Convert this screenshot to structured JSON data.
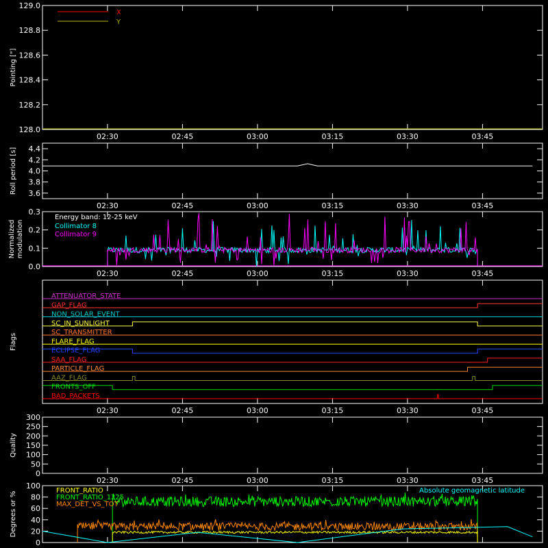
{
  "time_axis": {
    "ticks": [
      "02:30",
      "02:45",
      "03:00",
      "03:15",
      "03:30",
      "03:45"
    ]
  },
  "chart_data": [
    {
      "type": "line",
      "panel": "pointing",
      "ylabel": "Pointing [\"]",
      "ylim": [
        128.0,
        129.0
      ],
      "yticks": [
        "128.0",
        "128.2",
        "128.4",
        "128.6",
        "128.8",
        "129.0"
      ],
      "series": [
        {
          "name": "X",
          "color": "#ff0000",
          "values": []
        },
        {
          "name": "Y",
          "color": "#b8b800",
          "values": []
        }
      ]
    },
    {
      "type": "line",
      "panel": "roll",
      "ylabel": "Roll period [s]",
      "ylim": [
        3.5,
        4.5
      ],
      "yticks": [
        "3.6",
        "3.8",
        "4.0",
        "4.2",
        "4.4"
      ],
      "series": [
        {
          "color": "#ffffff",
          "x": [
            "02:17",
            "02:45",
            "03:00",
            "03:08",
            "03:10",
            "03:11",
            "03:12",
            "03:20",
            "03:30",
            "03:40",
            "03:55"
          ],
          "values": [
            4.09,
            4.09,
            4.09,
            4.09,
            4.13,
            4.11,
            4.09,
            4.09,
            4.09,
            4.09,
            4.09
          ]
        }
      ]
    },
    {
      "type": "line",
      "panel": "modulation",
      "ylabel": "Normalized modulation",
      "ylim": [
        0.0,
        0.3
      ],
      "yticks": [
        "0.0",
        "0.1",
        "0.2",
        "0.3"
      ],
      "annotation": "Energy band: 12-25 keV",
      "series": [
        {
          "name": "Collimator 8",
          "color": "#00ffff"
        },
        {
          "name": "Collimator 9",
          "color": "#ff00ff"
        }
      ],
      "active_range": [
        "02:30",
        "03:44"
      ],
      "baseline": 0.09
    },
    {
      "type": "line",
      "panel": "flags",
      "ylabel": "Flags",
      "flags": [
        {
          "name": "ATTENUATOR_STATE",
          "color": "#cc33cc",
          "steps": []
        },
        {
          "name": "GAP_FLAG",
          "color": "#ff3333",
          "steps": [
            [
              "03:44",
              1
            ]
          ]
        },
        {
          "name": "NON_SOLAR_EVENT",
          "color": "#00cccc",
          "steps": []
        },
        {
          "name": "SC_IN_SUNLIGHT",
          "color": "#ffff44",
          "steps": [
            [
              "02:35",
              1
            ],
            [
              "03:44",
              0
            ]
          ]
        },
        {
          "name": "SC_TRANSMITTER",
          "color": "#ff7733",
          "steps": []
        },
        {
          "name": "FLARE_FLAG",
          "color": "#ffff00",
          "steps": []
        },
        {
          "name": "ECLIPSE_FLAG",
          "color": "#2244ff",
          "steps": [
            [
              "02:35",
              0
            ],
            [
              "03:44",
              1
            ]
          ]
        },
        {
          "name": "SAA_FLAG",
          "color": "#ff2222",
          "steps": [
            [
              "03:46",
              1
            ]
          ]
        },
        {
          "name": "PARTICLE_FLAG",
          "color": "#ff8833",
          "steps": [
            [
              "03:42",
              1
            ]
          ]
        },
        {
          "name": "AAZ_FLAG",
          "color": "#888822",
          "steps": [
            [
              "02:35",
              1
            ],
            [
              "02:35.5",
              0
            ],
            [
              "03:43",
              1
            ],
            [
              "03:43.5",
              0
            ]
          ]
        },
        {
          "name": "FRONTS_OFF",
          "color": "#00dd00",
          "steps": [
            [
              "02:31",
              0
            ],
            [
              "03:47",
              1
            ]
          ]
        },
        {
          "name": "BAD_PACKETS",
          "color": "#ff0000",
          "steps": [
            [
              "03:36",
              1
            ],
            [
              "03:36.2",
              0
            ]
          ]
        }
      ]
    },
    {
      "type": "line",
      "panel": "quality",
      "ylabel": "Quality",
      "ylim": [
        0,
        300
      ],
      "yticks": [
        "0",
        "50",
        "100",
        "150",
        "200",
        "250",
        "300"
      ],
      "series": []
    },
    {
      "type": "line",
      "panel": "ratios",
      "ylabel": "Degrees or %",
      "ylim": [
        0,
        100
      ],
      "yticks": [
        "0",
        "20",
        "40",
        "60",
        "80",
        "100"
      ],
      "annotation": "Absolute geomagnetic latitude",
      "series": [
        {
          "name": "FRONT_RATIO",
          "color": "#ffff00",
          "level": 18
        },
        {
          "name": "FRONT_RATIO_1225",
          "color": "#00ff00",
          "level": 72
        },
        {
          "name": "MAX_DET_VS_TOT",
          "color": "#ff8800",
          "level": 28
        },
        {
          "name": "Absolute geomagnetic latitude",
          "color": "#00ffff",
          "x": [
            "02:17",
            "02:30",
            "02:48",
            "03:08",
            "03:29",
            "03:50",
            "03:55"
          ],
          "values": [
            20,
            0,
            18,
            0,
            24,
            28,
            10
          ]
        }
      ]
    }
  ]
}
